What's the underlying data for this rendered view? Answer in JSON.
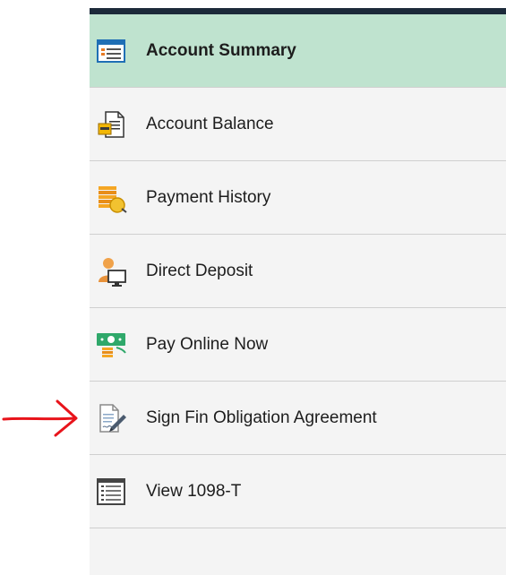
{
  "menu": {
    "items": [
      {
        "label": "Account Summary",
        "icon": "account-summary-icon",
        "active": true
      },
      {
        "label": "Account Balance",
        "icon": "account-balance-icon",
        "active": false
      },
      {
        "label": "Payment History",
        "icon": "payment-history-icon",
        "active": false
      },
      {
        "label": "Direct Deposit",
        "icon": "direct-deposit-icon",
        "active": false
      },
      {
        "label": "Pay Online Now",
        "icon": "pay-online-icon",
        "active": false
      },
      {
        "label": "Sign Fin Obligation Agreement",
        "icon": "sign-agreement-icon",
        "active": false
      },
      {
        "label": "View 1098-T",
        "icon": "view-1098t-icon",
        "active": false
      }
    ]
  },
  "colors": {
    "active_background": "#bfe3cf",
    "nav_background": "#f4f4f4",
    "top_border": "#1c2a3a",
    "annotation_arrow": "#e8141b"
  }
}
